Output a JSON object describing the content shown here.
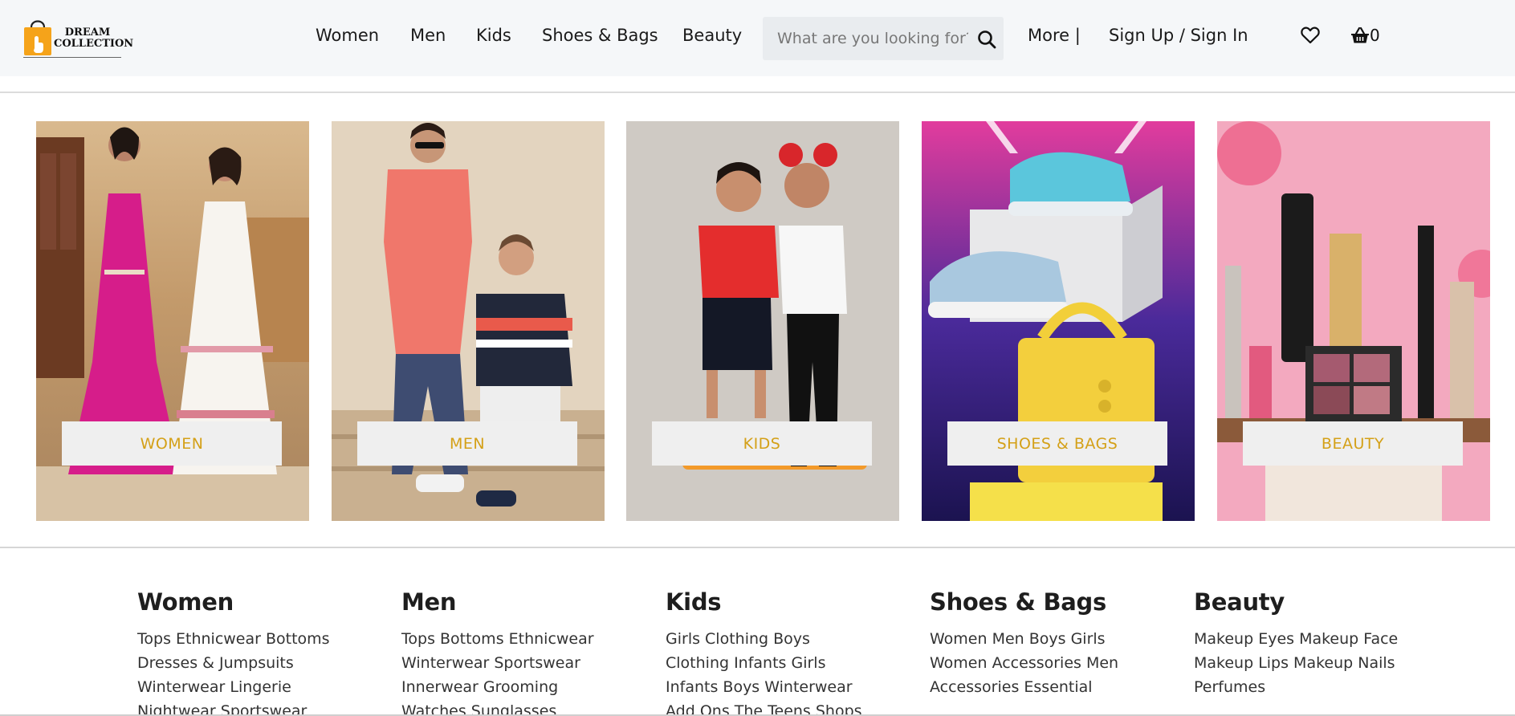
{
  "brand": {
    "line1": "DREAM",
    "line2": "COLLECTION",
    "accent": "#f5a31a"
  },
  "nav": {
    "items": [
      "Women",
      "Men",
      "Kids",
      "Shoes & Bags",
      "Beauty"
    ],
    "more_label": "More |",
    "auth_label": "Sign Up / Sign In",
    "cart_count": "0"
  },
  "search": {
    "placeholder": "What are you looking for?",
    "value": ""
  },
  "categories": [
    {
      "label": "WOMEN",
      "icon": "women-category-image"
    },
    {
      "label": "MEN",
      "icon": "men-category-image"
    },
    {
      "label": "KIDS",
      "icon": "kids-category-image"
    },
    {
      "label": "SHOES & BAGS",
      "icon": "shoes-bags-category-image"
    },
    {
      "label": "BEAUTY",
      "icon": "beauty-category-image"
    }
  ],
  "label_color": "#d4a017",
  "footer": {
    "columns": [
      {
        "title": "Women",
        "lines": [
          "Tops Ethnicwear Bottoms",
          "Dresses & Jumpsuits",
          "Winterwear Lingerie",
          "Nightwear Sportswear"
        ]
      },
      {
        "title": "Men",
        "lines": [
          "Tops Bottoms Ethnicwear",
          "Winterwear Sportswear",
          "Innerwear Grooming",
          "Watches Sunglasses"
        ]
      },
      {
        "title": "Kids",
        "lines": [
          "Girls Clothing Boys",
          "Clothing Infants Girls",
          "Infants Boys Winterwear",
          "Add Ons The Teens Shops"
        ]
      },
      {
        "title": "Shoes & Bags",
        "lines": [
          "Women Men Boys Girls",
          "Women Accessories Men",
          "Accessories Essential"
        ]
      },
      {
        "title": "Beauty",
        "lines": [
          "Makeup Eyes Makeup Face",
          "Makeup Lips Makeup Nails",
          "Perfumes"
        ]
      }
    ]
  }
}
